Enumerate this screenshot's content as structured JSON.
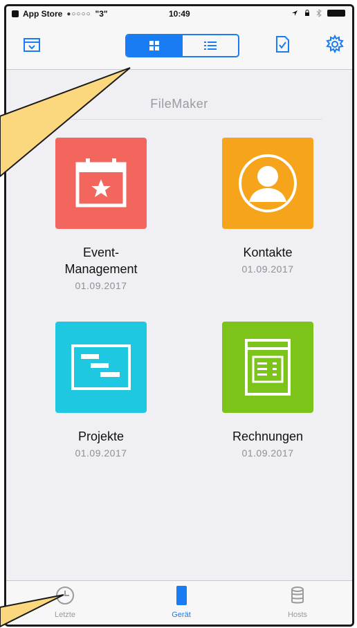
{
  "status_bar": {
    "back_app": "App Store",
    "signal": "●○○○○",
    "network": "\"3\"",
    "time": "10:49"
  },
  "navbar": {
    "view_mode": "grid"
  },
  "section": {
    "title": "FileMaker"
  },
  "files": [
    {
      "name": "Event-\nManagement",
      "date": "01.09.2017",
      "color": "#f2665e",
      "icon": "calendar-star-icon"
    },
    {
      "name": "Kontakte",
      "date": "01.09.2017",
      "color": "#f7a41d",
      "icon": "person-icon"
    },
    {
      "name": "Projekte",
      "date": "01.09.2017",
      "color": "#1ec8e0",
      "icon": "gantt-icon"
    },
    {
      "name": "Rechnungen",
      "date": "01.09.2017",
      "color": "#7cc41a",
      "icon": "invoice-window-icon"
    }
  ],
  "tabs": [
    {
      "label": "Letzte",
      "icon": "clock-icon",
      "active": false
    },
    {
      "label": "Gerät",
      "icon": "phone-device-icon",
      "active": true
    },
    {
      "label": "Hosts",
      "icon": "database-icon",
      "active": false
    }
  ],
  "colors": {
    "accent": "#1a7cf2",
    "callout_fill": "#fbd77e",
    "background": "#efeff4"
  }
}
